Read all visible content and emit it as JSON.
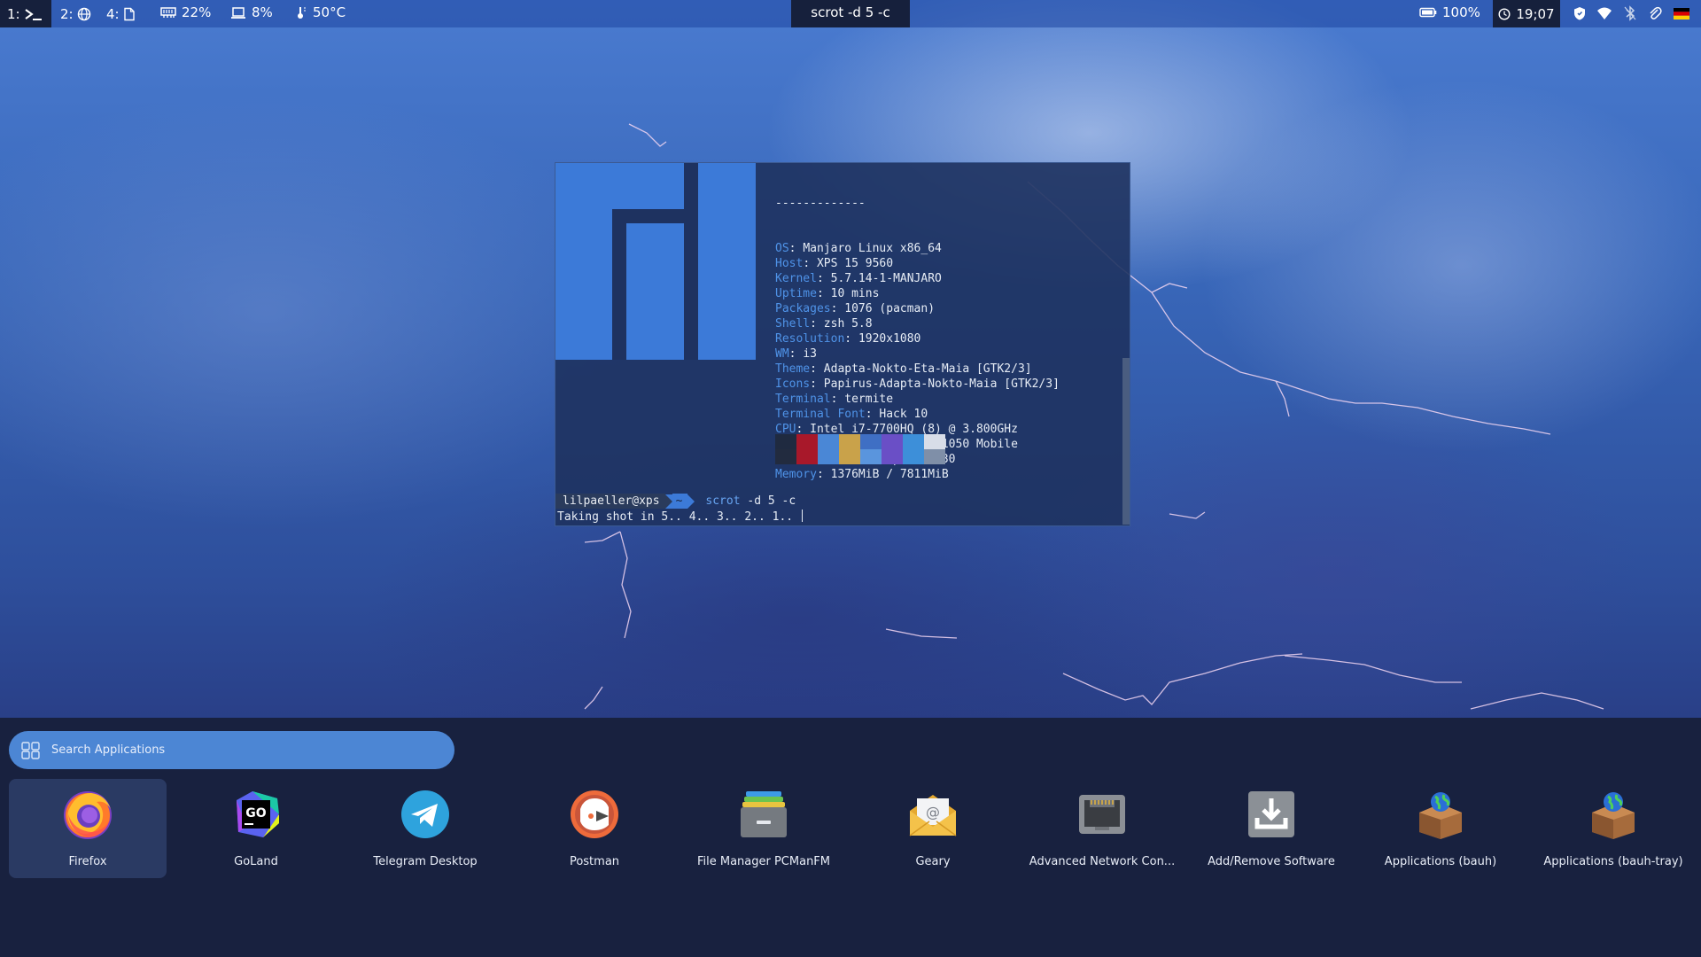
{
  "topbar": {
    "workspaces": [
      {
        "number": "1:",
        "icon": "terminal-icon",
        "active": true
      },
      {
        "number": "2:",
        "icon": "globe-icon",
        "active": false
      },
      {
        "number": "4:",
        "icon": "document-icon",
        "active": false
      }
    ],
    "memory": "22%",
    "cpu": "8%",
    "temperature": "50°C",
    "window_title": "scrot -d 5 -c",
    "battery": "100%",
    "clock": "19;07",
    "tray": [
      "shield-icon",
      "wifi-icon",
      "bluetooth-icon",
      "paperclip-icon",
      "german-flag-icon"
    ]
  },
  "terminal": {
    "separator": "-------------",
    "info": [
      {
        "key": "OS",
        "value": "Manjaro Linux x86_64"
      },
      {
        "key": "Host",
        "value": "XPS 15 9560"
      },
      {
        "key": "Kernel",
        "value": "5.7.14-1-MANJARO"
      },
      {
        "key": "Uptime",
        "value": "10 mins"
      },
      {
        "key": "Packages",
        "value": "1076 (pacman)"
      },
      {
        "key": "Shell",
        "value": "zsh 5.8"
      },
      {
        "key": "Resolution",
        "value": "1920x1080"
      },
      {
        "key": "WM",
        "value": "i3"
      },
      {
        "key": "Theme",
        "value": "Adapta-Nokto-Eta-Maia [GTK2/3]"
      },
      {
        "key": "Icons",
        "value": "Papirus-Adapta-Nokto-Maia [GTK2/3]"
      },
      {
        "key": "Terminal",
        "value": "termite"
      },
      {
        "key": "Terminal Font",
        "value": "Hack 10"
      },
      {
        "key": "CPU",
        "value": "Intel i7-7700HQ (8) @ 3.800GHz"
      },
      {
        "key": "GPU",
        "value": "NVIDIA GeForce GTX 1050 Mobile"
      },
      {
        "key": "GPU",
        "value": "Intel HD Graphics 630"
      },
      {
        "key": "Memory",
        "value": "1376MiB / 7811MiB"
      }
    ],
    "palette": [
      [
        "#1f2a40",
        "#222b3f"
      ],
      [
        "#a8182a",
        "#a8182a"
      ],
      [
        "#4a87d6",
        "#4a87d6"
      ],
      [
        "#c9a24a",
        "#c9a24a"
      ],
      [
        "#3f6fc4",
        "#5a95dd"
      ],
      [
        "#6a4fc6",
        "#6a4fc6"
      ],
      [
        "#3d8fd9",
        "#3d8fd9"
      ],
      [
        "#d8dde8",
        "#7f8fa8"
      ]
    ],
    "prompt_user": "lilpaeller@xps",
    "prompt_dir": "~",
    "command": "scrot",
    "command_args": " -d 5 -c",
    "output": "Taking shot in 5.. 4.. 3.. 2.. 1.. "
  },
  "launcher": {
    "search_placeholder": "Search Applications",
    "apps": [
      {
        "label": "Firefox",
        "icon": "firefox-icon",
        "selected": true
      },
      {
        "label": "GoLand",
        "icon": "goland-icon",
        "selected": false
      },
      {
        "label": "Telegram Desktop",
        "icon": "telegram-icon",
        "selected": false
      },
      {
        "label": "Postman",
        "icon": "postman-icon",
        "selected": false
      },
      {
        "label": "File Manager PCManFM",
        "icon": "file-manager-icon",
        "selected": false
      },
      {
        "label": "Geary",
        "icon": "mail-icon",
        "selected": false
      },
      {
        "label": "Advanced Network Con...",
        "icon": "network-icon",
        "selected": false
      },
      {
        "label": "Add/Remove Software",
        "icon": "download-icon",
        "selected": false
      },
      {
        "label": "Applications (bauh)",
        "icon": "package-globe-icon",
        "selected": false
      },
      {
        "label": "Applications (bauh-tray)",
        "icon": "package-globe-icon",
        "selected": false
      }
    ]
  }
}
